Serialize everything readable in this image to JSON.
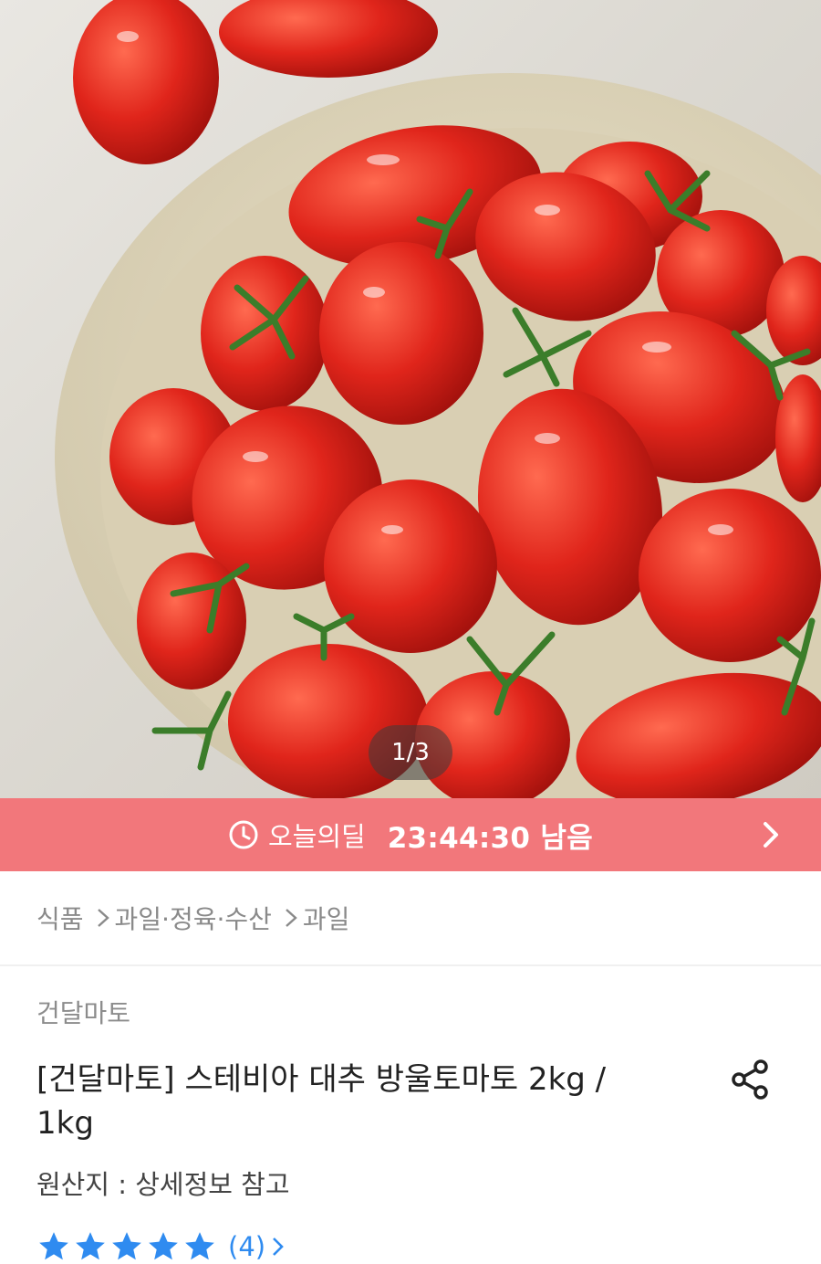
{
  "product_image": {
    "page_indicator": "1/3",
    "icon": "tomato-product-photo"
  },
  "deal_bar": {
    "clock_icon": "clock-icon",
    "label": "오늘의딜",
    "timer": "23:44:30 남음",
    "arrow_icon": "chevron-right-icon",
    "background_color": "#f2777b"
  },
  "breadcrumb": {
    "items": [
      "식품",
      "과일·정육·수산",
      "과일"
    ]
  },
  "product": {
    "seller": "건달마토",
    "title": "[건달마토] 스테비아 대추 방울토마토 2kg / 1kg",
    "origin": "원산지 : 상세정보 참고",
    "rating": {
      "stars": 5,
      "review_count": "(4)",
      "color": "#2f8bf0"
    }
  }
}
